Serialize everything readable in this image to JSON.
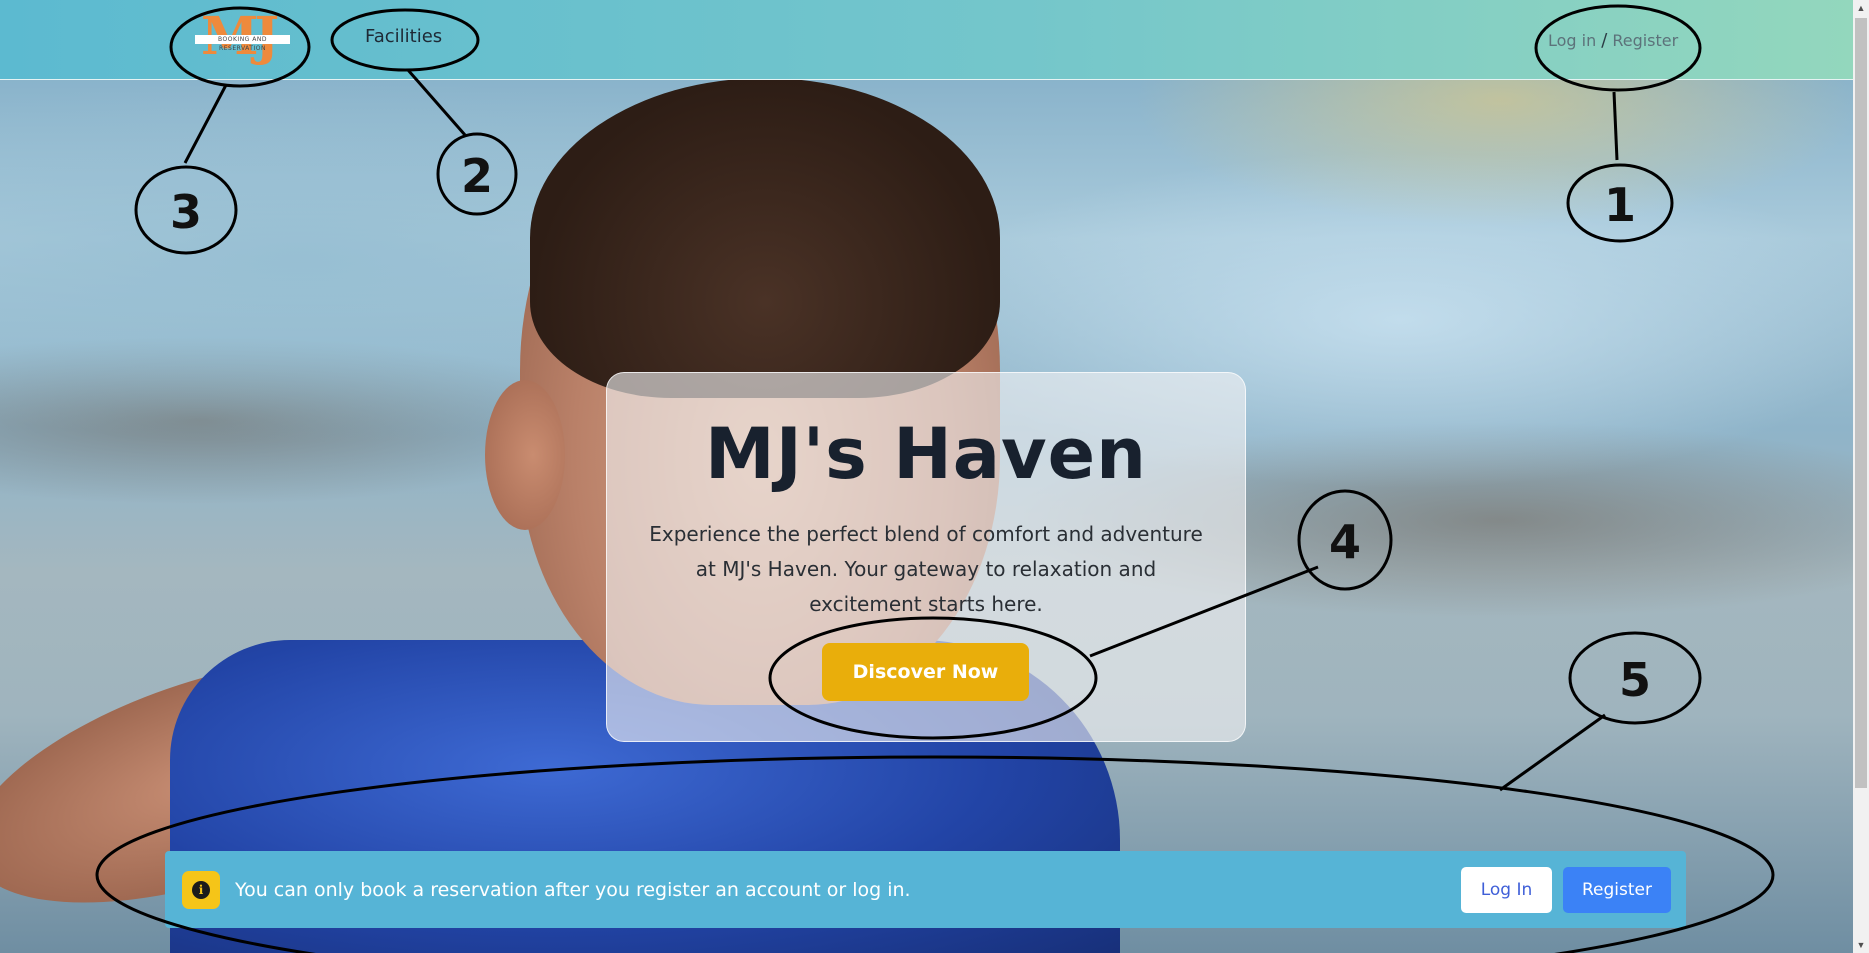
{
  "header": {
    "logo": {
      "letters": "MJ",
      "tagline": "BOOKING AND RESERVATION"
    },
    "nav": {
      "facilities_label": "Facilities"
    },
    "auth": {
      "login_label": "Log in",
      "separator": "/",
      "register_label": "Register"
    }
  },
  "hero": {
    "title": "MJ's Haven",
    "description": "Experience the perfect blend of comfort and adventure at MJ's Haven. Your gateway to relaxation and excitement starts here.",
    "cta_label": "Discover Now"
  },
  "notice": {
    "icon": "info-icon",
    "icon_glyph": "i",
    "message": "You can only book a reservation after you register an account or log in.",
    "login_label": "Log In",
    "register_label": "Register"
  },
  "annotations": {
    "labels": [
      "1",
      "2",
      "3",
      "4",
      "5"
    ]
  },
  "colors": {
    "header_gradient_start": "#5cbad0",
    "header_gradient_end": "#93d7bd",
    "cta_yellow": "#e9ae0b",
    "notice_blue": "#56b4d6",
    "register_blue": "#3b82f6",
    "login_text": "#3f5fd8"
  }
}
